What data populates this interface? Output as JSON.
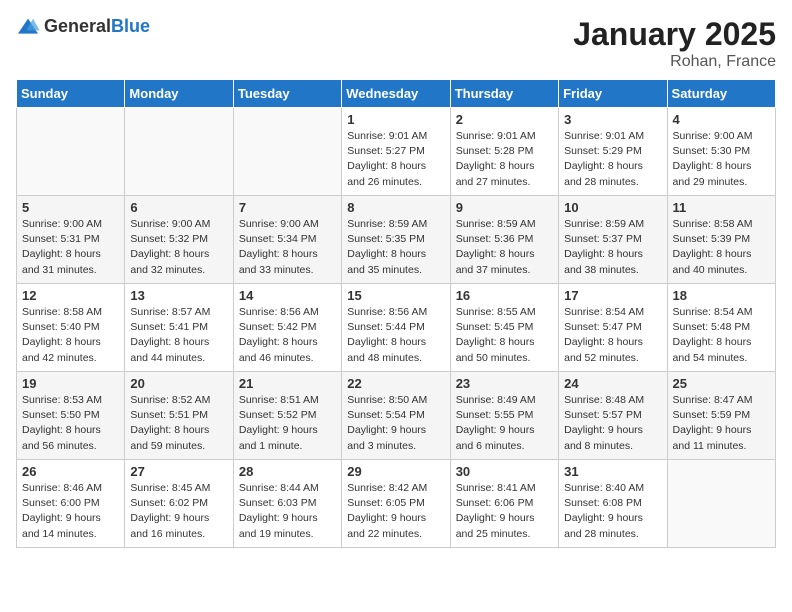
{
  "header": {
    "logo_general": "General",
    "logo_blue": "Blue",
    "title": "January 2025",
    "subtitle": "Rohan, France"
  },
  "days_of_week": [
    "Sunday",
    "Monday",
    "Tuesday",
    "Wednesday",
    "Thursday",
    "Friday",
    "Saturday"
  ],
  "weeks": [
    [
      {
        "day": "",
        "info": ""
      },
      {
        "day": "",
        "info": ""
      },
      {
        "day": "",
        "info": ""
      },
      {
        "day": "1",
        "info": "Sunrise: 9:01 AM\nSunset: 5:27 PM\nDaylight: 8 hours\nand 26 minutes."
      },
      {
        "day": "2",
        "info": "Sunrise: 9:01 AM\nSunset: 5:28 PM\nDaylight: 8 hours\nand 27 minutes."
      },
      {
        "day": "3",
        "info": "Sunrise: 9:01 AM\nSunset: 5:29 PM\nDaylight: 8 hours\nand 28 minutes."
      },
      {
        "day": "4",
        "info": "Sunrise: 9:00 AM\nSunset: 5:30 PM\nDaylight: 8 hours\nand 29 minutes."
      }
    ],
    [
      {
        "day": "5",
        "info": "Sunrise: 9:00 AM\nSunset: 5:31 PM\nDaylight: 8 hours\nand 31 minutes."
      },
      {
        "day": "6",
        "info": "Sunrise: 9:00 AM\nSunset: 5:32 PM\nDaylight: 8 hours\nand 32 minutes."
      },
      {
        "day": "7",
        "info": "Sunrise: 9:00 AM\nSunset: 5:34 PM\nDaylight: 8 hours\nand 33 minutes."
      },
      {
        "day": "8",
        "info": "Sunrise: 8:59 AM\nSunset: 5:35 PM\nDaylight: 8 hours\nand 35 minutes."
      },
      {
        "day": "9",
        "info": "Sunrise: 8:59 AM\nSunset: 5:36 PM\nDaylight: 8 hours\nand 37 minutes."
      },
      {
        "day": "10",
        "info": "Sunrise: 8:59 AM\nSunset: 5:37 PM\nDaylight: 8 hours\nand 38 minutes."
      },
      {
        "day": "11",
        "info": "Sunrise: 8:58 AM\nSunset: 5:39 PM\nDaylight: 8 hours\nand 40 minutes."
      }
    ],
    [
      {
        "day": "12",
        "info": "Sunrise: 8:58 AM\nSunset: 5:40 PM\nDaylight: 8 hours\nand 42 minutes."
      },
      {
        "day": "13",
        "info": "Sunrise: 8:57 AM\nSunset: 5:41 PM\nDaylight: 8 hours\nand 44 minutes."
      },
      {
        "day": "14",
        "info": "Sunrise: 8:56 AM\nSunset: 5:42 PM\nDaylight: 8 hours\nand 46 minutes."
      },
      {
        "day": "15",
        "info": "Sunrise: 8:56 AM\nSunset: 5:44 PM\nDaylight: 8 hours\nand 48 minutes."
      },
      {
        "day": "16",
        "info": "Sunrise: 8:55 AM\nSunset: 5:45 PM\nDaylight: 8 hours\nand 50 minutes."
      },
      {
        "day": "17",
        "info": "Sunrise: 8:54 AM\nSunset: 5:47 PM\nDaylight: 8 hours\nand 52 minutes."
      },
      {
        "day": "18",
        "info": "Sunrise: 8:54 AM\nSunset: 5:48 PM\nDaylight: 8 hours\nand 54 minutes."
      }
    ],
    [
      {
        "day": "19",
        "info": "Sunrise: 8:53 AM\nSunset: 5:50 PM\nDaylight: 8 hours\nand 56 minutes."
      },
      {
        "day": "20",
        "info": "Sunrise: 8:52 AM\nSunset: 5:51 PM\nDaylight: 8 hours\nand 59 minutes."
      },
      {
        "day": "21",
        "info": "Sunrise: 8:51 AM\nSunset: 5:52 PM\nDaylight: 9 hours\nand 1 minute."
      },
      {
        "day": "22",
        "info": "Sunrise: 8:50 AM\nSunset: 5:54 PM\nDaylight: 9 hours\nand 3 minutes."
      },
      {
        "day": "23",
        "info": "Sunrise: 8:49 AM\nSunset: 5:55 PM\nDaylight: 9 hours\nand 6 minutes."
      },
      {
        "day": "24",
        "info": "Sunrise: 8:48 AM\nSunset: 5:57 PM\nDaylight: 9 hours\nand 8 minutes."
      },
      {
        "day": "25",
        "info": "Sunrise: 8:47 AM\nSunset: 5:59 PM\nDaylight: 9 hours\nand 11 minutes."
      }
    ],
    [
      {
        "day": "26",
        "info": "Sunrise: 8:46 AM\nSunset: 6:00 PM\nDaylight: 9 hours\nand 14 minutes."
      },
      {
        "day": "27",
        "info": "Sunrise: 8:45 AM\nSunset: 6:02 PM\nDaylight: 9 hours\nand 16 minutes."
      },
      {
        "day": "28",
        "info": "Sunrise: 8:44 AM\nSunset: 6:03 PM\nDaylight: 9 hours\nand 19 minutes."
      },
      {
        "day": "29",
        "info": "Sunrise: 8:42 AM\nSunset: 6:05 PM\nDaylight: 9 hours\nand 22 minutes."
      },
      {
        "day": "30",
        "info": "Sunrise: 8:41 AM\nSunset: 6:06 PM\nDaylight: 9 hours\nand 25 minutes."
      },
      {
        "day": "31",
        "info": "Sunrise: 8:40 AM\nSunset: 6:08 PM\nDaylight: 9 hours\nand 28 minutes."
      },
      {
        "day": "",
        "info": ""
      }
    ]
  ]
}
